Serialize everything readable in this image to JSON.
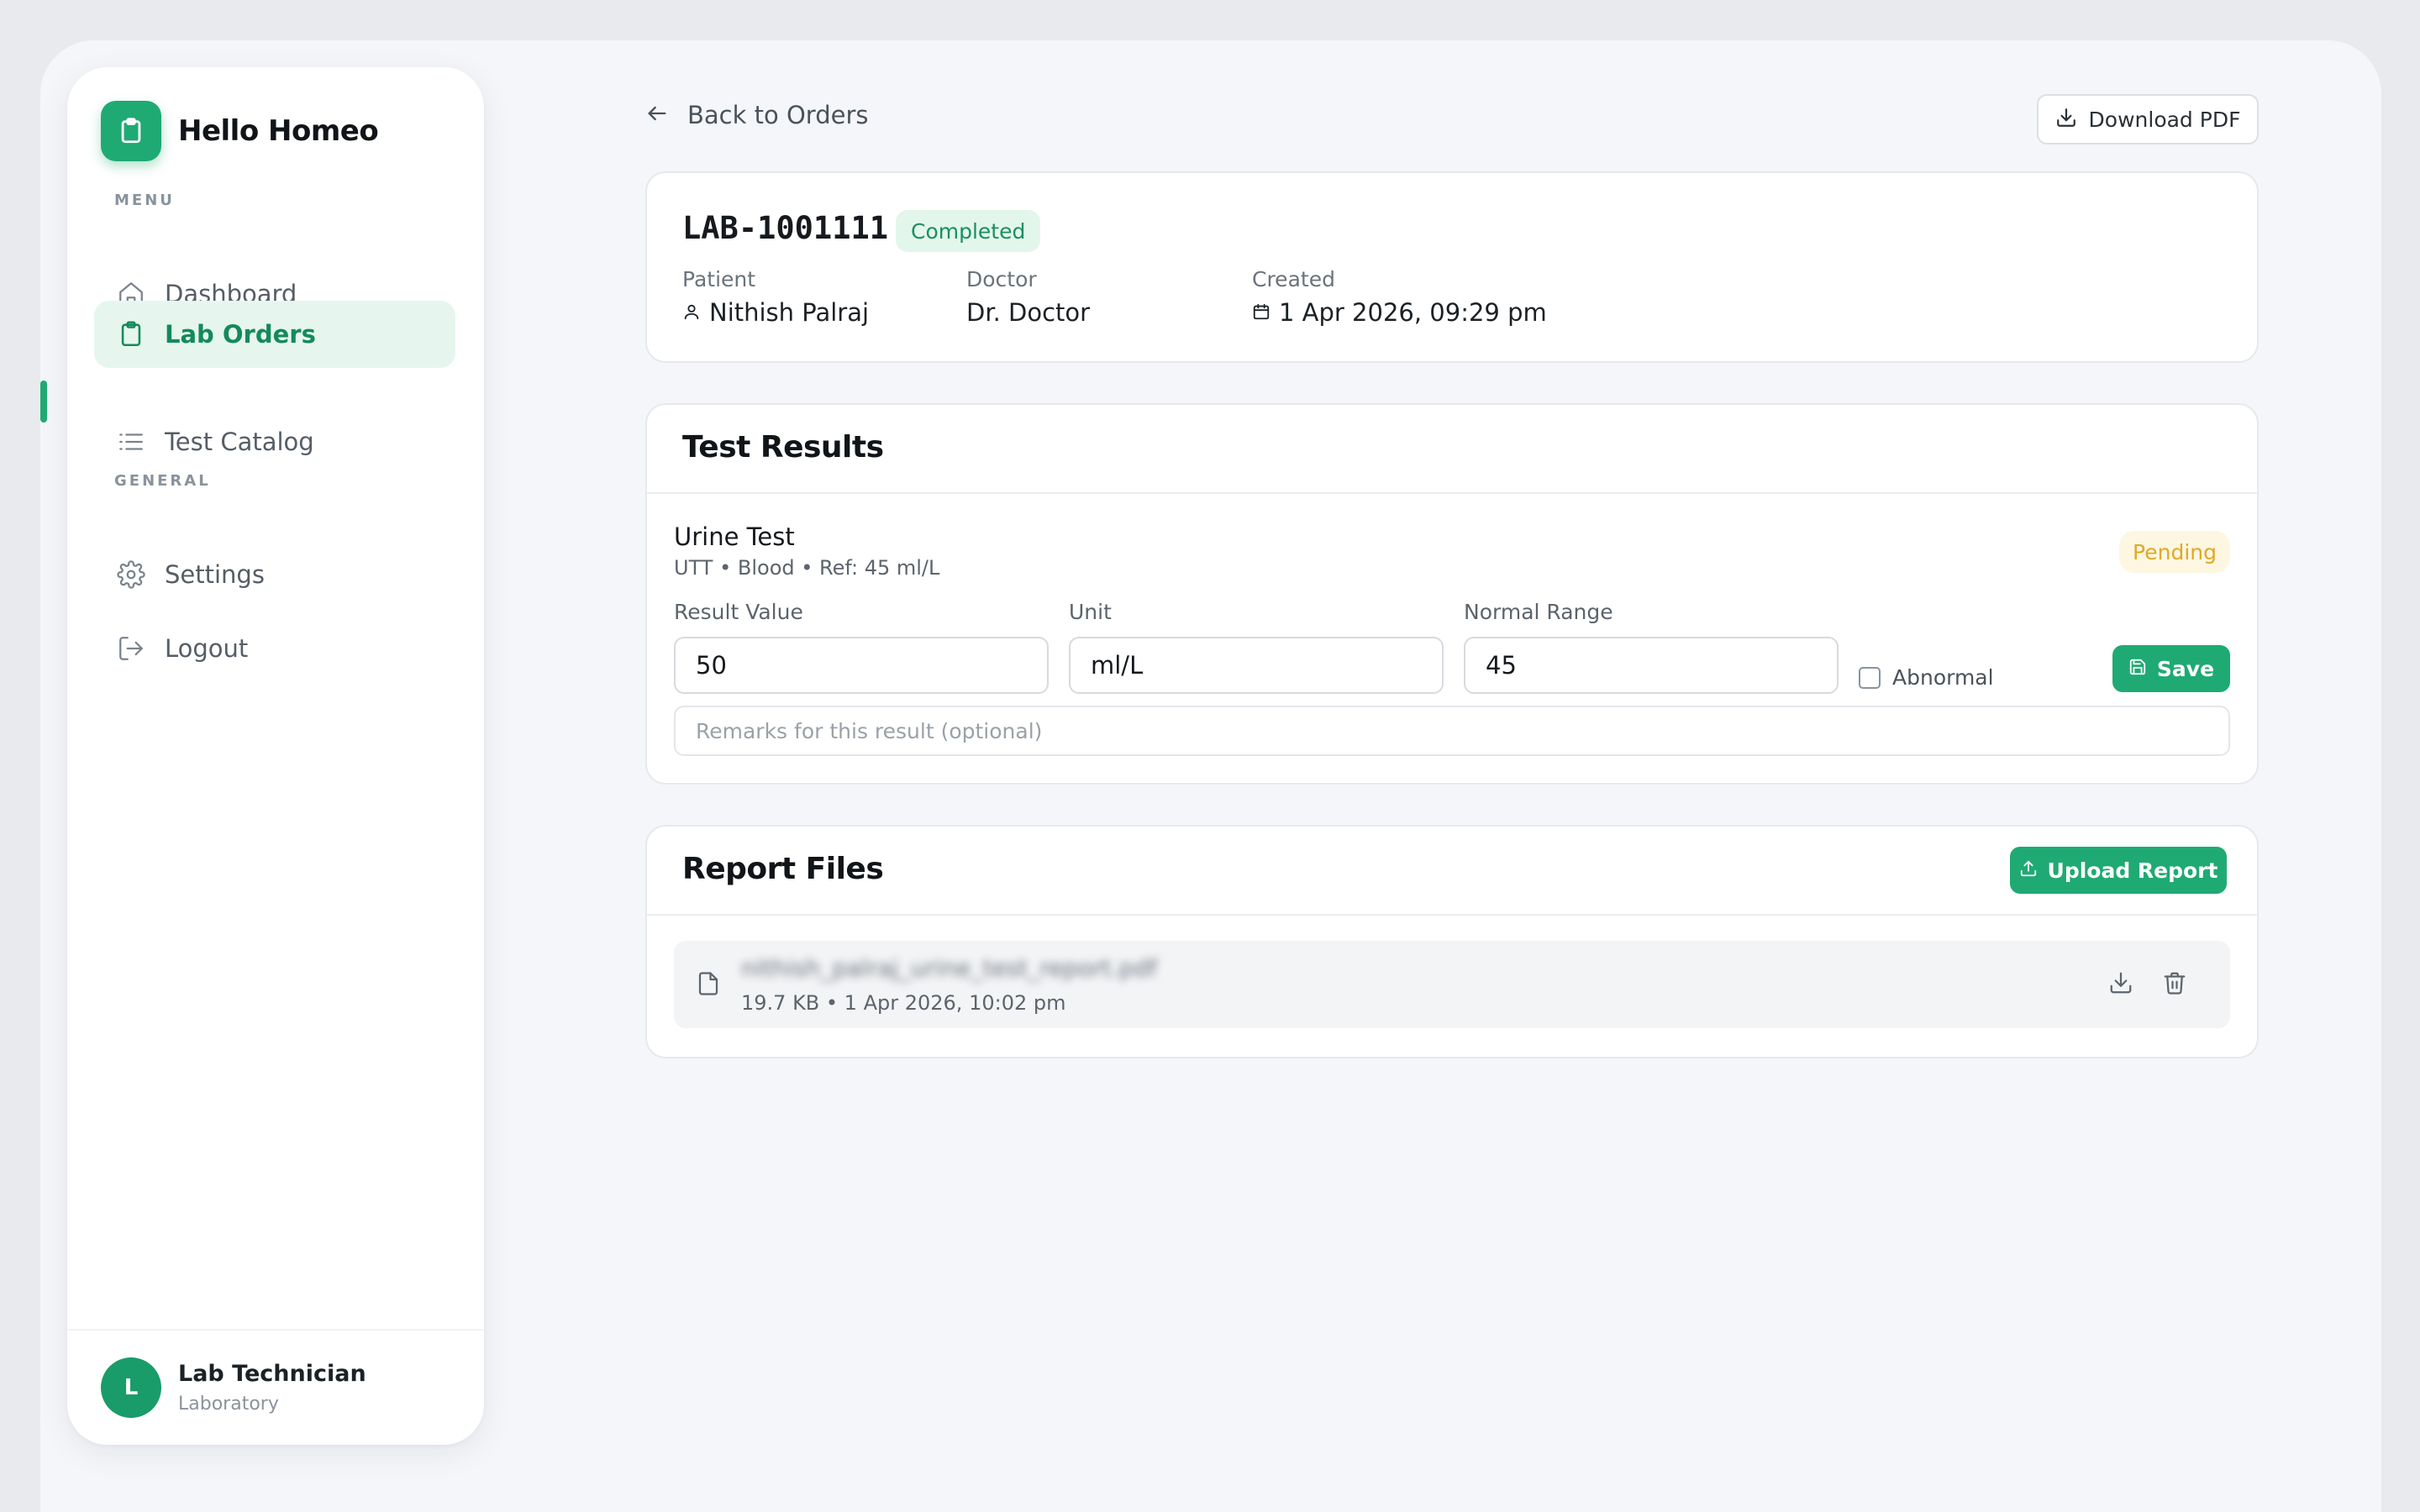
{
  "brand": {
    "name": "Hello Homeo"
  },
  "sidebar": {
    "menu_label": "MENU",
    "general_label": "GENERAL",
    "items": [
      {
        "label": "Dashboard",
        "icon": "home-icon"
      },
      {
        "label": "Lab Orders",
        "icon": "clipboard-icon",
        "active": true
      },
      {
        "label": "Test Catalog",
        "icon": "list-icon"
      },
      {
        "label": "Settings",
        "icon": "gear-icon"
      },
      {
        "label": "Logout",
        "icon": "logout-icon"
      }
    ],
    "user": {
      "initial": "L",
      "name": "Lab Technician",
      "role": "Laboratory"
    }
  },
  "header": {
    "back_label": "Back to Orders",
    "download_label": "Download PDF"
  },
  "order": {
    "id": "LAB-1001111",
    "status": "Completed",
    "patient_label": "Patient",
    "patient": "Nithish Palraj",
    "doctor_label": "Doctor",
    "doctor": "Dr. Doctor",
    "created_label": "Created",
    "created": "1 Apr 2026, 09:29 pm"
  },
  "results": {
    "title": "Test Results",
    "test": {
      "name": "Urine Test",
      "subtitle": "UTT • Blood • Ref: 45 ml/L",
      "status": "Pending",
      "result_label": "Result Value",
      "result_value": "50",
      "unit_label": "Unit",
      "unit_value": "ml/L",
      "range_label": "Normal Range",
      "range_value": "45",
      "abnormal_label": "Abnormal",
      "save_label": "Save",
      "remarks_placeholder": "Remarks for this result (optional)"
    }
  },
  "files": {
    "title": "Report Files",
    "upload_label": "Upload Report",
    "items": [
      {
        "name": "nithish_palraj_urine_test_report.pdf",
        "meta": "19.7 KB • 1 Apr 2026, 10:02 pm"
      }
    ]
  },
  "colors": {
    "accent": "#1faa73",
    "pending": "#e0a928",
    "completed_bg": "#e3f6ec"
  }
}
